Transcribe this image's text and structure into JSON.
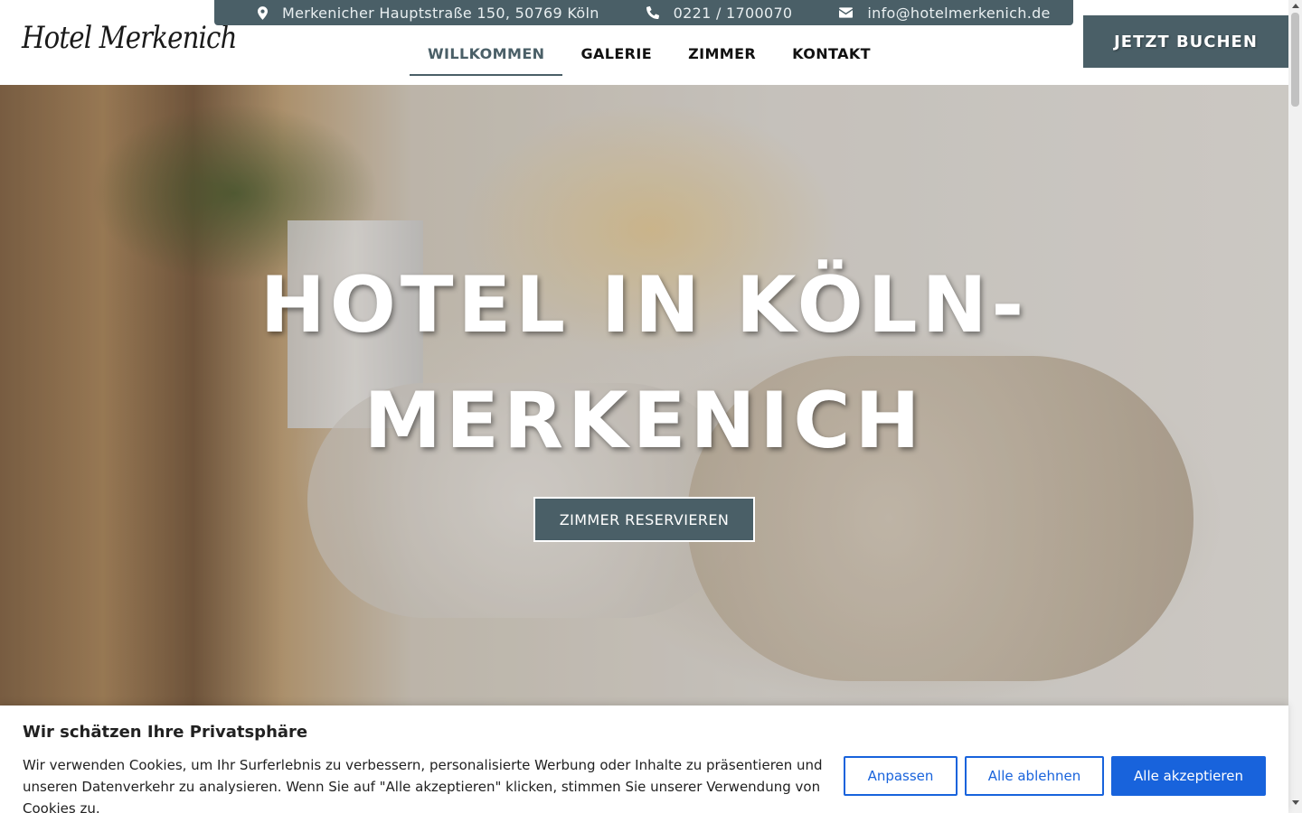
{
  "header": {
    "logo_text": "Hotel Merkenich",
    "topbar": {
      "address": "Merkenicher Hauptstraße 150, 50769 Köln",
      "phone": "0221 / 1700070",
      "email": "info@hotelmerkenich.de",
      "address_icon": "map-marker-icon",
      "phone_icon": "phone-icon",
      "email_icon": "envelope-icon"
    },
    "nav": [
      {
        "label": "WILLKOMMEN",
        "active": true
      },
      {
        "label": "GALERIE",
        "active": false
      },
      {
        "label": "ZIMMER",
        "active": false
      },
      {
        "label": "KONTAKT",
        "active": false
      }
    ],
    "book_button": "JETZT BUCHEN"
  },
  "hero": {
    "title_line1": "HOTEL IN KÖLN-",
    "title_line2": "MERKENICH",
    "cta": "ZIMMER RESERVIEREN"
  },
  "cookie": {
    "title": "Wir schätzen Ihre Privatsphäre",
    "text": "Wir verwenden Cookies, um Ihr Surferlebnis zu verbessern, personalisierte Werbung oder Inhalte zu präsentieren und unseren Datenverkehr zu analysieren. Wenn Sie auf \"Alle akzeptieren\" klicken, stimmen Sie unserer Verwendung von Cookies zu.",
    "customize": "Anpassen",
    "reject": "Alle ablehnen",
    "accept": "Alle akzeptieren"
  },
  "colors": {
    "brand": "#4a5f67",
    "cookie_accent": "#1863dc"
  }
}
